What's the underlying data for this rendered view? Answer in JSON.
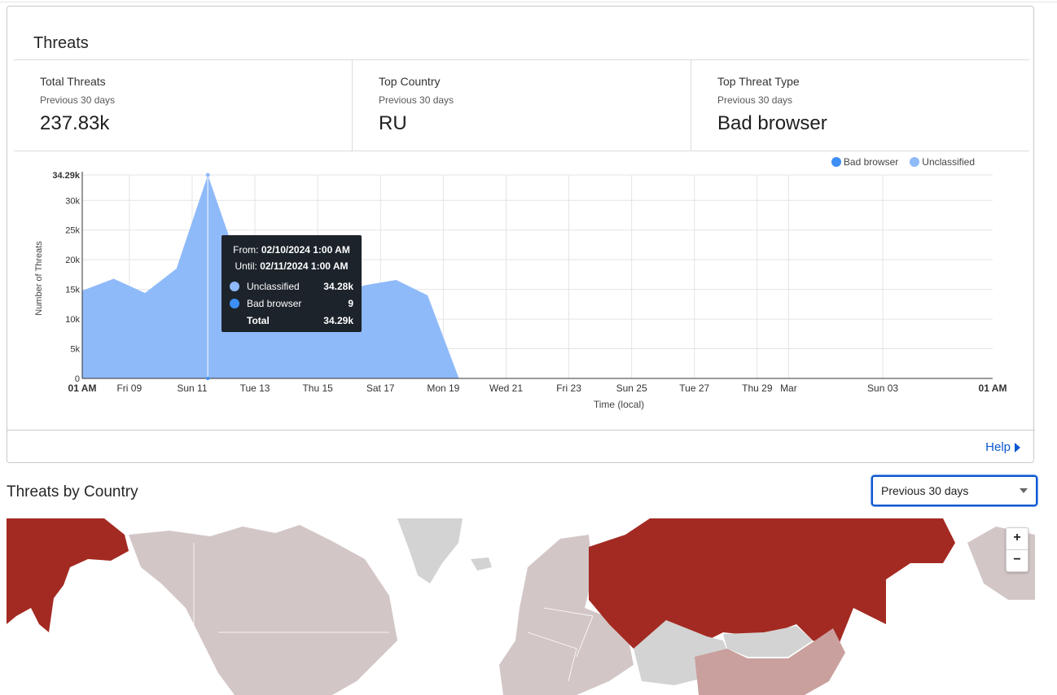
{
  "threats_card": {
    "title": "Threats",
    "stats": [
      {
        "label": "Total Threats",
        "sub": "Previous 30 days",
        "value": "237.83k"
      },
      {
        "label": "Top Country",
        "sub": "Previous 30 days",
        "value": "RU"
      },
      {
        "label": "Top Threat Type",
        "sub": "Previous 30 days",
        "value": "Bad browser"
      }
    ],
    "legend": [
      {
        "name": "Bad browser",
        "color": "#3d8ff5"
      },
      {
        "name": "Unclassified",
        "color": "#8fbaf9"
      }
    ],
    "tooltip": {
      "from_label": "From:",
      "from_value": "02/10/2024 1:00 AM",
      "until_label": "Until:",
      "until_value": "02/11/2024 1:00 AM",
      "rows": [
        {
          "name": "Unclassified",
          "value": "34.28k",
          "color": "#8fbaf9"
        },
        {
          "name": "Bad browser",
          "value": "9",
          "color": "#3d8ff5"
        }
      ],
      "total_label": "Total",
      "total_value": "34.29k"
    },
    "help_label": "Help"
  },
  "chart_data": {
    "type": "area",
    "title": "",
    "xlabel": "Time (local)",
    "ylabel": "Number of Threats",
    "ylim": [
      0,
      34290
    ],
    "y_ticks": [
      {
        "label": "0",
        "value": 0
      },
      {
        "label": "5k",
        "value": 5000
      },
      {
        "label": "10k",
        "value": 10000
      },
      {
        "label": "15k",
        "value": 15000
      },
      {
        "label": "20k",
        "value": 20000
      },
      {
        "label": "25k",
        "value": 25000
      },
      {
        "label": "30k",
        "value": 30000
      },
      {
        "label": "34.29k",
        "value": 34290,
        "bold": true
      }
    ],
    "x_ticks": [
      {
        "label": "01 AM",
        "day": 0,
        "bold": true
      },
      {
        "label": "Fri 09",
        "day": 1.5
      },
      {
        "label": "Sun 11",
        "day": 3.5
      },
      {
        "label": "Tue 13",
        "day": 5.5
      },
      {
        "label": "Thu 15",
        "day": 7.5
      },
      {
        "label": "Sat 17",
        "day": 9.5
      },
      {
        "label": "Mon 19",
        "day": 11.5
      },
      {
        "label": "Wed 21",
        "day": 13.5
      },
      {
        "label": "Fri 23",
        "day": 15.5
      },
      {
        "label": "Sun 25",
        "day": 17.5
      },
      {
        "label": "Tue 27",
        "day": 19.5
      },
      {
        "label": "Thu 29",
        "day": 21.5
      },
      {
        "label": "Mar",
        "day": 22.5
      },
      {
        "label": "Sun 03",
        "day": 25.5
      },
      {
        "label": "01 AM",
        "day": 29,
        "bold": true
      }
    ],
    "x_days": [
      0,
      1,
      2,
      3,
      4,
      5,
      6,
      7,
      8,
      9,
      10,
      11,
      12,
      13
    ],
    "series": [
      {
        "name": "Unclassified",
        "color": "#8fbaf9",
        "values": [
          14800,
          16800,
          14400,
          18500,
          34280,
          19000,
          15500,
          14000,
          14000,
          15700,
          16600,
          14000,
          0,
          0
        ]
      },
      {
        "name": "Bad browser",
        "color": "#3d8ff5",
        "values": [
          0,
          0,
          0,
          0,
          9,
          0,
          0,
          0,
          0,
          0,
          0,
          0,
          0,
          0
        ]
      }
    ],
    "hover_day": 4,
    "grid": true,
    "legend_position": "top-right"
  },
  "country_section": {
    "title": "Threats by Country",
    "period_select": "Previous 30 days",
    "zoom_in": "+",
    "zoom_out": "−",
    "colors": {
      "high": "#a32a22",
      "mid": "#c9a09d",
      "low": "#d3c6c6",
      "none": "#d3d3d3",
      "ocean": "#ffffff"
    }
  }
}
